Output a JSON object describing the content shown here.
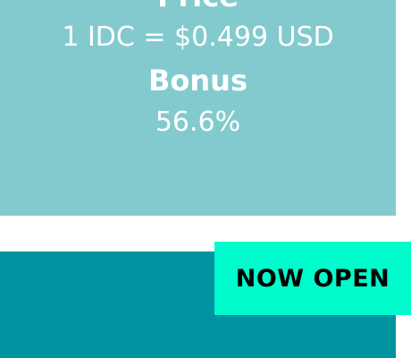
{
  "price_card": {
    "price_heading": "Price",
    "price_value": "1 IDC = $0.499 USD",
    "bonus_heading": "Bonus",
    "bonus_value": "56.6%"
  },
  "status_badge": {
    "label": "NOW OPEN"
  },
  "colors": {
    "price_card_bg": "#83cace",
    "next_card_bg": "#0094a0",
    "badge_bg": "#00fccc"
  }
}
